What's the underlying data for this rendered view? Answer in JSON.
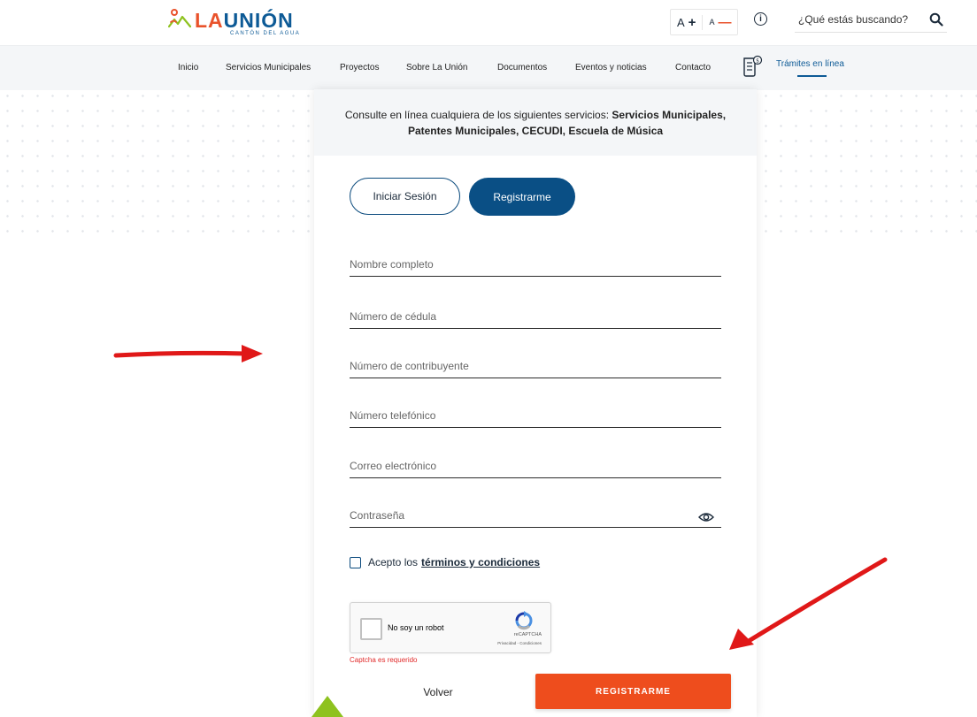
{
  "header": {
    "logo_la": "LA",
    "logo_union": "UNIÓN",
    "logo_subtitle": "CANTÓN DEL AGUA",
    "font_increase_label": "A",
    "font_decrease_label": "A",
    "search_placeholder": "¿Qué estás buscando?"
  },
  "nav": {
    "items": [
      "Inicio",
      "Servicios Municipales",
      "Proyectos",
      "Sobre La Unión",
      "Documentos",
      "Eventos y noticias",
      "Contacto"
    ],
    "tramites_label": "Trámites en línea"
  },
  "form": {
    "intro_text": "Consulte en línea cualquiera de los siguientes servicios: ",
    "intro_bold": "Servicios Municipales, Patentes Municipales, CECUDI, Escuela de Música",
    "login_tab": "Iniciar Sesión",
    "register_tab": "Registrarme",
    "fields": {
      "full_name": "Nombre completo",
      "id_number": "Número de cédula",
      "taxpayer_number": "Número de contribuyente",
      "phone": "Número telefónico",
      "email": "Correo electrónico",
      "password": "Contraseña"
    },
    "terms_prefix": "Acepto los",
    "terms_link": "términos y condiciones",
    "captcha_label": "No soy un robot",
    "captcha_brand": "reCAPTCHA",
    "captcha_links": "Privacidad - Condiciones",
    "captcha_error": "Captcha es requerido",
    "back_label": "Volver",
    "submit_label": "REGISTRARME"
  },
  "colors": {
    "brand_blue": "#0a4f85",
    "brand_orange": "#ee4d1d",
    "annotation_red": "#e01818",
    "annotation_green": "#8ec21f"
  }
}
